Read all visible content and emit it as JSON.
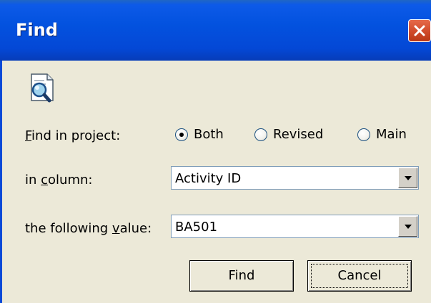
{
  "window": {
    "title": "Find",
    "close_icon": "close-icon"
  },
  "icon": "find-document-icon",
  "find_in_project": {
    "label_pre": "",
    "label_accel": "F",
    "label_post": "ind in project:",
    "options": [
      {
        "label": "Both",
        "selected": true
      },
      {
        "label": "Revised",
        "selected": false
      },
      {
        "label": "Main",
        "selected": false
      }
    ]
  },
  "column": {
    "label_pre": "in ",
    "label_accel": "c",
    "label_post": "olumn:",
    "value": "Activity ID"
  },
  "value_field": {
    "label_pre": "the following ",
    "label_accel": "v",
    "label_post": "alue:",
    "value": "BA501"
  },
  "buttons": {
    "find": "Find",
    "cancel": "Cancel"
  }
}
